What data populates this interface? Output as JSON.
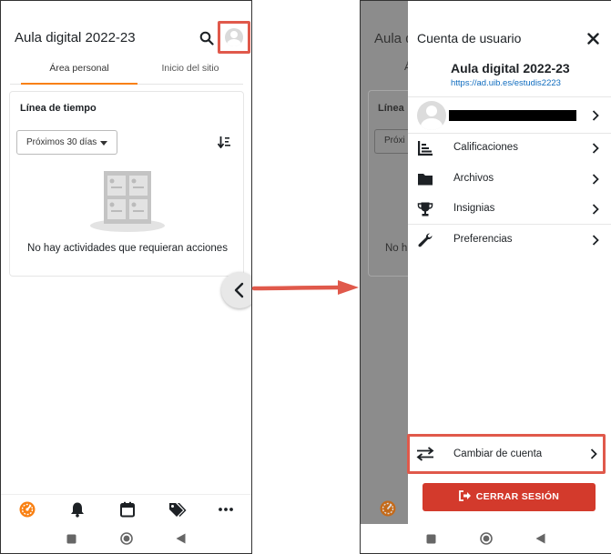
{
  "left_screen": {
    "header": {
      "title": "Aula digital 2022-23",
      "search_icon": "search-icon",
      "avatar_icon": "user-avatar-icon"
    },
    "tabs": [
      {
        "label": "Área personal",
        "active": true
      },
      {
        "label": "Inicio del sitio",
        "active": false
      }
    ],
    "timeline": {
      "title": "Línea de tiempo",
      "filter_selected": "Próximos 30 días",
      "sort_icon": "sort-icon",
      "empty_message": "No hay actividades que requieran acciones"
    },
    "bottom_nav": [
      "dashboard-icon",
      "bell-icon",
      "calendar-icon",
      "tags-icon",
      "more-icon"
    ],
    "system_nav": [
      "square-icon",
      "circle-icon",
      "back-triangle-icon"
    ]
  },
  "right_screen": {
    "drawer": {
      "title": "Cuenta de usuario",
      "site_name": "Aula digital 2022-23",
      "site_url": "https://ad.uib.es/estudis2223",
      "menu": [
        {
          "label": "Calificaciones",
          "icon": "grades-icon"
        },
        {
          "label": "Archivos",
          "icon": "folder-icon"
        },
        {
          "label": "Insignias",
          "icon": "trophy-icon"
        },
        {
          "label": "Preferencias",
          "icon": "wrench-icon"
        }
      ],
      "switch_account": "Cambiar de cuenta",
      "logout": "CERRAR SESIÓN"
    },
    "background_fragments": {
      "title": "Aula d",
      "tab_fragment": "Á",
      "timeline_fragment": "Línea",
      "filter_fragment": "Próxi",
      "empty_fragment": "No h"
    }
  },
  "colors": {
    "accent": "#f98012",
    "highlight": "#e0594b",
    "logout": "#d33a2c",
    "link": "#0f6cbf"
  }
}
